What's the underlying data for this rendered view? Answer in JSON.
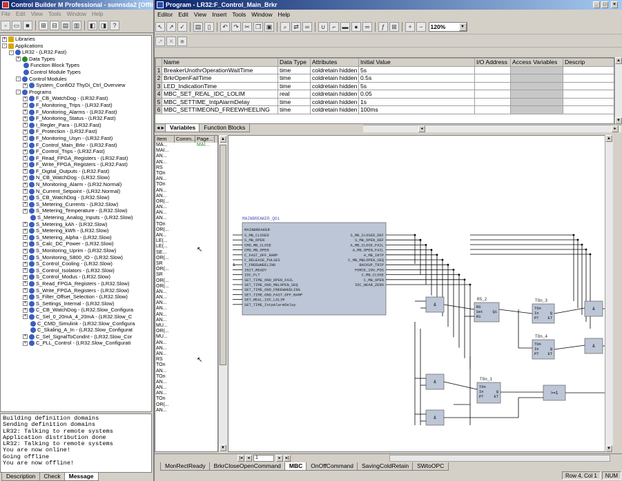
{
  "outer_window": {
    "title": "Control Builder M Professional - sunnsda2 [Offline]"
  },
  "outer_menu": [
    "File",
    "Edit",
    "View",
    "Tools",
    "Window",
    "Help"
  ],
  "tree": [
    {
      "label": "Libraries",
      "level": 0,
      "exp": "+",
      "icon": "f"
    },
    {
      "label": "Applications",
      "level": 0,
      "exp": "-",
      "icon": "f"
    },
    {
      "label": "LR32 - (LR32.Fast)",
      "level": 1,
      "exp": "-",
      "icon": "b"
    },
    {
      "label": "Data Types",
      "level": 2,
      "exp": "+",
      "icon": "g"
    },
    {
      "label": "Function Block Types",
      "level": 2,
      "exp": "",
      "icon": "b"
    },
    {
      "label": "Control Module Types",
      "level": 2,
      "exp": "",
      "icon": "b"
    },
    {
      "label": "Control Modules",
      "level": 2,
      "exp": "-",
      "icon": "b"
    },
    {
      "label": "System_ConfiO2  ThyDi_Ctrl_Overview",
      "level": 3,
      "exp": "+",
      "icon": "b"
    },
    {
      "label": "Programs",
      "level": 2,
      "exp": "-",
      "icon": "b"
    },
    {
      "label": "F_CB_WatchDog - (LR32.Fast)",
      "level": 3,
      "exp": "+",
      "icon": "b"
    },
    {
      "label": "F_Monitoring_Trips - (LR32.Fast)",
      "level": 3,
      "exp": "+",
      "icon": "b"
    },
    {
      "label": "F_Monitoring_Alarms - (LR32.Fast)",
      "level": 3,
      "exp": "+",
      "icon": "b"
    },
    {
      "label": "F_Monitoring_Status - (LR32.Fast)",
      "level": 3,
      "exp": "+",
      "icon": "b"
    },
    {
      "label": "I_Regler_Para - (LR32.Fast)",
      "level": 3,
      "exp": "+",
      "icon": "b"
    },
    {
      "label": "F_Protection - (LR32.Fast)",
      "level": 3,
      "exp": "+",
      "icon": "b"
    },
    {
      "label": "F_Monitoring_Usyn - (LR32.Fast)",
      "level": 3,
      "exp": "+",
      "icon": "b"
    },
    {
      "label": "F_Control_Main_Brkr - (LR32.Fast)",
      "level": 3,
      "exp": "+",
      "icon": "b"
    },
    {
      "label": "F_Control_Trips - (LR32.Fast)",
      "level": 3,
      "exp": "+",
      "icon": "b"
    },
    {
      "label": "F_Read_FPGA_Registers - (LR32.Fast)",
      "level": 3,
      "exp": "+",
      "icon": "b"
    },
    {
      "label": "F_Write_FPGA_Registers - (LR32.Fast)",
      "level": 3,
      "exp": "+",
      "icon": "b"
    },
    {
      "label": "F_Digital_Outputs - (LR32.Fast)",
      "level": 3,
      "exp": "+",
      "icon": "b"
    },
    {
      "label": "N_CB_WatchDog - (LR32.Slow)",
      "level": 3,
      "exp": "+",
      "icon": "b"
    },
    {
      "label": "N_Monitoring_Alarm - (LR32.Normal)",
      "level": 3,
      "exp": "+",
      "icon": "b"
    },
    {
      "label": "N_Current_Setpoint - (LR32.Normal)",
      "level": 3,
      "exp": "+",
      "icon": "b"
    },
    {
      "label": "S_CB_WatchDog - (LR32.Slow)",
      "level": 3,
      "exp": "+",
      "icon": "b"
    },
    {
      "label": "S_Metering_Currents - (LR32.Slow)",
      "level": 3,
      "exp": "+",
      "icon": "b"
    },
    {
      "label": "S_Metering_Temperature - (LR32.Slow)",
      "level": 3,
      "exp": "+",
      "icon": "b"
    },
    {
      "label": "S_Metering_Analog_Inputs - (LR32.Slow)",
      "level": 3,
      "exp": "",
      "icon": "b"
    },
    {
      "label": "S_Metering_kAh - (LR32.Slow)",
      "level": 3,
      "exp": "+",
      "icon": "b"
    },
    {
      "label": "S_Metering_kWh - (LR32.Slow)",
      "level": 3,
      "exp": "+",
      "icon": "b"
    },
    {
      "label": "S_Metering_Alpha - (LR32.Slow)",
      "level": 3,
      "exp": "+",
      "icon": "b"
    },
    {
      "label": "S_Calc_DC_Power - (LR32.Slow)",
      "level": 3,
      "exp": "+",
      "icon": "b"
    },
    {
      "label": "S_Monitoring_Uprim - (LR32.Slow)",
      "level": 3,
      "exp": "+",
      "icon": "b"
    },
    {
      "label": "S_Monitoring_S800_IO - (LR32.Slow)",
      "level": 3,
      "exp": "+",
      "icon": "b"
    },
    {
      "label": "S_Control_Cooling - (LR32.Slow)",
      "level": 3,
      "exp": "+",
      "icon": "b"
    },
    {
      "label": "S_Control_Isolators - (LR32.Slow)",
      "level": 3,
      "exp": "+",
      "icon": "b"
    },
    {
      "label": "S_Control_Modus - (LR32.Slow)",
      "level": 3,
      "exp": "+",
      "icon": "b"
    },
    {
      "label": "S_Read_FPGA_Registers - (LR32.Slow)",
      "level": 3,
      "exp": "+",
      "icon": "b"
    },
    {
      "label": "S_Write_FPGA_Registers - (LR32.Slow)",
      "level": 3,
      "exp": "+",
      "icon": "b"
    },
    {
      "label": "S_Filter_Offset_Selection - (LR32.Slow)",
      "level": 3,
      "exp": "+",
      "icon": "b"
    },
    {
      "label": "S_Settings_Internal - (LR32.Slow)",
      "level": 3,
      "exp": "+",
      "icon": "b"
    },
    {
      "label": "C_CB_WatchDog - (LR32.Slow_Configura",
      "level": 3,
      "exp": "+",
      "icon": "b"
    },
    {
      "label": "C_Sel_0_20mA_4_20mA - (LR32.Slow_C",
      "level": 3,
      "exp": "+",
      "icon": "b"
    },
    {
      "label": "C_CMD_Simulink - (LR32.Slow_Configura",
      "level": 3,
      "exp": "",
      "icon": "b"
    },
    {
      "label": "C_Skaling_A_In - (LR32.Slow_Configurat",
      "level": 3,
      "exp": "",
      "icon": "b"
    },
    {
      "label": "C_Sel_SignalToCondnt - (LR32.Slow_Cor",
      "level": 3,
      "exp": "+",
      "icon": "b"
    },
    {
      "label": "C_PLL_Control - (LR32.Slow_Configurati",
      "level": 3,
      "exp": "+",
      "icon": "b"
    }
  ],
  "messages": [
    "Building definition domains",
    "Sending definition domains",
    "LR32: Talking to remote systems",
    "Application distribution done",
    "LR32: Talking to remote systems",
    "You are now online!",
    "Going offline",
    "You are now offline!"
  ],
  "bottom_tabs": [
    "Description",
    "Check",
    "Message"
  ],
  "inner_window": {
    "title": "Program - LR32:F_Control_Main_Brkr"
  },
  "inner_menu": [
    "Editor",
    "Edit",
    "View",
    "Insert",
    "Tools",
    "Window",
    "Help"
  ],
  "zoom": "120%",
  "var_columns": [
    "Name",
    "Data Type",
    "Attributes",
    "Initial Value",
    "I/O Address",
    "Access Variables",
    "Descrip"
  ],
  "variables": [
    {
      "n": "1",
      "name": "BreakerUnothrOperationWaitTime",
      "type": "time",
      "attr": "coldretain hidden",
      "init": "5s"
    },
    {
      "n": "2",
      "name": "BrkrOpenFailTime",
      "type": "time",
      "attr": "coldretain hidden",
      "init": "0.5s"
    },
    {
      "n": "3",
      "name": "LED_IndicationTime",
      "type": "time",
      "attr": "coldretain hidden",
      "init": "5s"
    },
    {
      "n": "4",
      "name": "MBC_SET_REAL_IDC_LOLIM",
      "type": "real",
      "attr": "coldretain hidden",
      "init": "0.05"
    },
    {
      "n": "5",
      "name": "MBC_SETTIME_IntpAlarmDelay",
      "type": "time",
      "attr": "coldretain hidden",
      "init": "1s"
    },
    {
      "n": "6",
      "name": "MBC_SETTIMEOND_FREEWHEELING",
      "type": "time",
      "attr": "coldretain hidden",
      "init": "100ms"
    }
  ],
  "var_tabs": [
    "Variables",
    "Function Blocks"
  ],
  "list_headers": [
    "Item",
    "Comm...",
    "Page..."
  ],
  "list_items": [
    "MA...",
    "MAI...",
    "AN...",
    "AN...",
    "RS",
    "TOn",
    "AN...",
    "TOn",
    "AN...",
    "AN...",
    "OR(...",
    "AN...",
    "AN...",
    "AN...",
    "TOn",
    "OR(...",
    "AN...",
    "LE(...",
    "LE(...",
    "SE...",
    "OR(...",
    "SR",
    "OR(...",
    "SR",
    "OR(...",
    "OR(...",
    "AN...",
    "AN...",
    "AN...",
    "AN...",
    "AN...",
    "AN...",
    "MU...",
    "OR(...",
    "MU...",
    "AN...",
    "AN...",
    "AN...",
    "RS",
    "TOn",
    "AN...",
    "TOn",
    "AN...",
    "AN...",
    "AN...",
    "TOn",
    "OR(...",
    "AN..."
  ],
  "list_page_first": "MAI...",
  "fb": {
    "instance": "MAINBREAKER_QO1",
    "type_name": "MAINBREAKER",
    "inputs": [
      "S_MB_CLOSED",
      "S_MB_OPEN",
      "CMD_MB_CLOSE",
      "CMD_MB_OPEN",
      "C_FAST_OFF_RAMP",
      "C_RELEASE_PULSES",
      "T_FREEWHEELING",
      "INIT_READY",
      "IDC_FLT",
      "SET_TIME_OND_OPEN_FAIL",
      "SET_TIME_OND_MBLOPEN_SEQ",
      "SET_TIME_OND_FREEWHEELING",
      "SET_TIME_OND_FAST_OFF_RAMP",
      "SET_REAL_IDC_LOLIM",
      "SET_TIME_IntpAlarmDelay"
    ],
    "outputs": [
      "S_MB_CLOSED_DEF",
      "S_MB_OPEN_DEF",
      "A_MB_CLOSE_FAIL",
      "A_MB_OPEN_FAIL",
      "A_MB_INTP",
      "C_MB_MBLOPEN_SEQ",
      "BACKUP_TRIP",
      "FORCE_INV_POS",
      "C_MB_CLOSE",
      "C_MB_OPEN",
      "IDC_NEAR_ZERO"
    ]
  },
  "rs2": {
    "name": "RS_2",
    "pins": [
      "RS",
      "Set",
      "Q1",
      "R1"
    ]
  },
  "ton3": {
    "name": "TOn_3",
    "pins": [
      "TOn",
      "In",
      "Q",
      "PT",
      "ET"
    ]
  },
  "ton4": {
    "name": "TOn_4",
    "pins": [
      "TOn",
      "In",
      "Q",
      "PT",
      "ET"
    ]
  },
  "ton1": {
    "name": "TOn_1",
    "pins": [
      "TOn",
      "In",
      "Q",
      "PT",
      "ET"
    ]
  },
  "and_label": "&",
  "or_label": ">=1",
  "left_input_marker": "1",
  "page_nav": {
    "page": "1"
  },
  "code_tabs": [
    "MonRectReady",
    "BrkrCloseOpenCommand",
    "MBC",
    "OnOffCommand",
    "SavingColdRetain",
    "SWtoOPC"
  ],
  "status": {
    "pos": "Row 4, Col 1",
    "num": "NUM"
  },
  "icons": {
    "toolbar": "toolbar-icons"
  }
}
